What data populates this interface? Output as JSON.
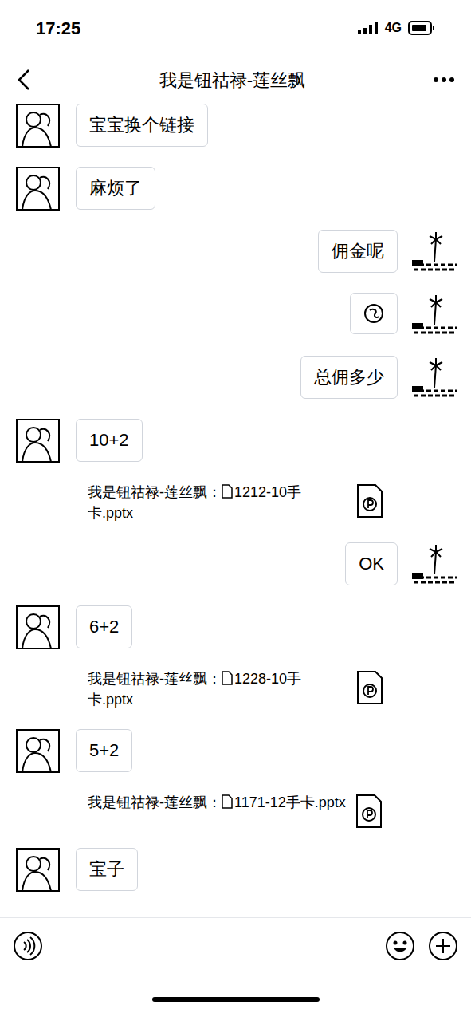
{
  "status_bar": {
    "time": "17:25",
    "network": "4G"
  },
  "header": {
    "title": "我是钮祜禄-莲丝飘"
  },
  "messages": [
    {
      "side": "left",
      "kind": "text",
      "text": "宝宝换个链接"
    },
    {
      "side": "left",
      "kind": "text",
      "text": "麻烦了"
    },
    {
      "side": "right",
      "kind": "text",
      "text": "佣金呢"
    },
    {
      "side": "right",
      "kind": "emoji"
    },
    {
      "side": "right",
      "kind": "text",
      "text": "总佣多少"
    },
    {
      "side": "left",
      "kind": "text",
      "text": "10+2"
    },
    {
      "side": "left",
      "kind": "file",
      "sender": "我是钮祜禄-莲丝飘：",
      "file": "1212-10手卡.pptx"
    },
    {
      "side": "right",
      "kind": "text",
      "text": "OK"
    },
    {
      "side": "left",
      "kind": "text",
      "text": "6+2"
    },
    {
      "side": "left",
      "kind": "file",
      "sender": "我是钮祜禄-莲丝飘：",
      "file": "1228-10手卡.pptx"
    },
    {
      "side": "left",
      "kind": "text",
      "text": "5+2"
    },
    {
      "side": "left",
      "kind": "file",
      "sender": "我是钮祜禄-莲丝飘：",
      "file": "1171-12手卡.pptx"
    },
    {
      "side": "left",
      "kind": "text",
      "text": "宝子"
    }
  ]
}
